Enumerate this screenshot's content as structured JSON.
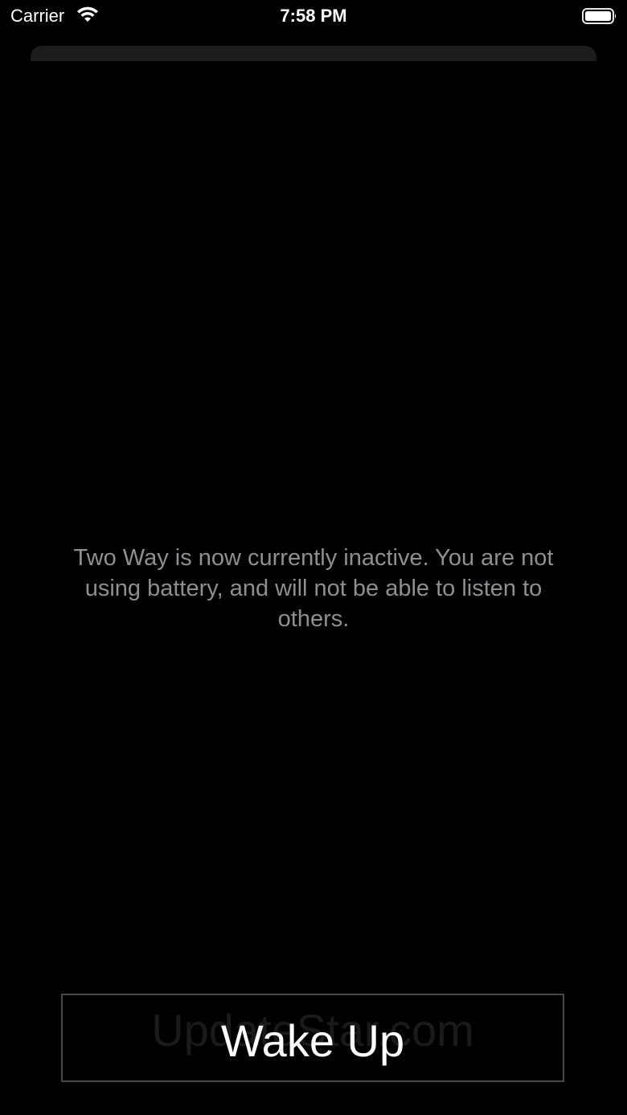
{
  "status_bar": {
    "carrier": "Carrier",
    "time": "7:58 PM",
    "wifi_icon": "wifi-icon",
    "battery_icon": "battery-full-icon"
  },
  "main": {
    "message": "Two Way is now currently inactive.  You are not using battery, and will not be able to listen to others."
  },
  "wake_button": {
    "label": "Wake Up",
    "watermark": "UpdateStar.com"
  },
  "colors": {
    "background": "#000000",
    "message_text": "#8e8e93",
    "button_border": "#48484a",
    "button_text": "#ffffff"
  }
}
